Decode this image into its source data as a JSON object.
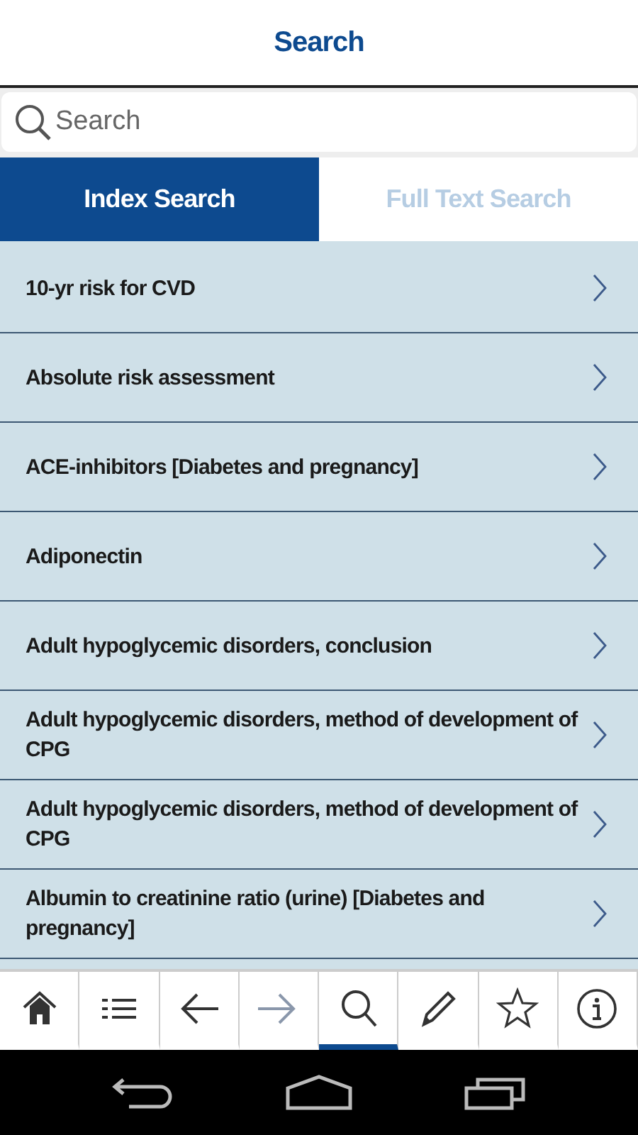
{
  "header": {
    "title": "Search"
  },
  "search": {
    "placeholder": "Search"
  },
  "tabs": [
    {
      "label": "Index Search",
      "selected": true
    },
    {
      "label": "Full Text Search",
      "selected": false
    }
  ],
  "results": [
    {
      "label": "10-yr risk for CVD"
    },
    {
      "label": "Absolute risk assessment"
    },
    {
      "label": "ACE-inhibitors [Diabetes and pregnancy]"
    },
    {
      "label": "Adiponectin"
    },
    {
      "label": "Adult hypoglycemic disorders, conclusion"
    },
    {
      "label": "Adult hypoglycemic disorders, method of development of CPG"
    },
    {
      "label": "Adult hypoglycemic disorders, method of development of CPG"
    },
    {
      "label": "Albumin to creatinine ratio (urine) [Diabetes and pregnancy]"
    }
  ],
  "toolbar": [
    {
      "kind": "home",
      "selected": false,
      "disabled": false
    },
    {
      "kind": "list",
      "selected": false,
      "disabled": false
    },
    {
      "kind": "back",
      "selected": false,
      "disabled": false
    },
    {
      "kind": "forward",
      "selected": false,
      "disabled": true
    },
    {
      "kind": "search",
      "selected": true,
      "disabled": false
    },
    {
      "kind": "edit",
      "selected": false,
      "disabled": false
    },
    {
      "kind": "star",
      "selected": false,
      "disabled": false
    },
    {
      "kind": "info",
      "selected": false,
      "disabled": false
    }
  ]
}
